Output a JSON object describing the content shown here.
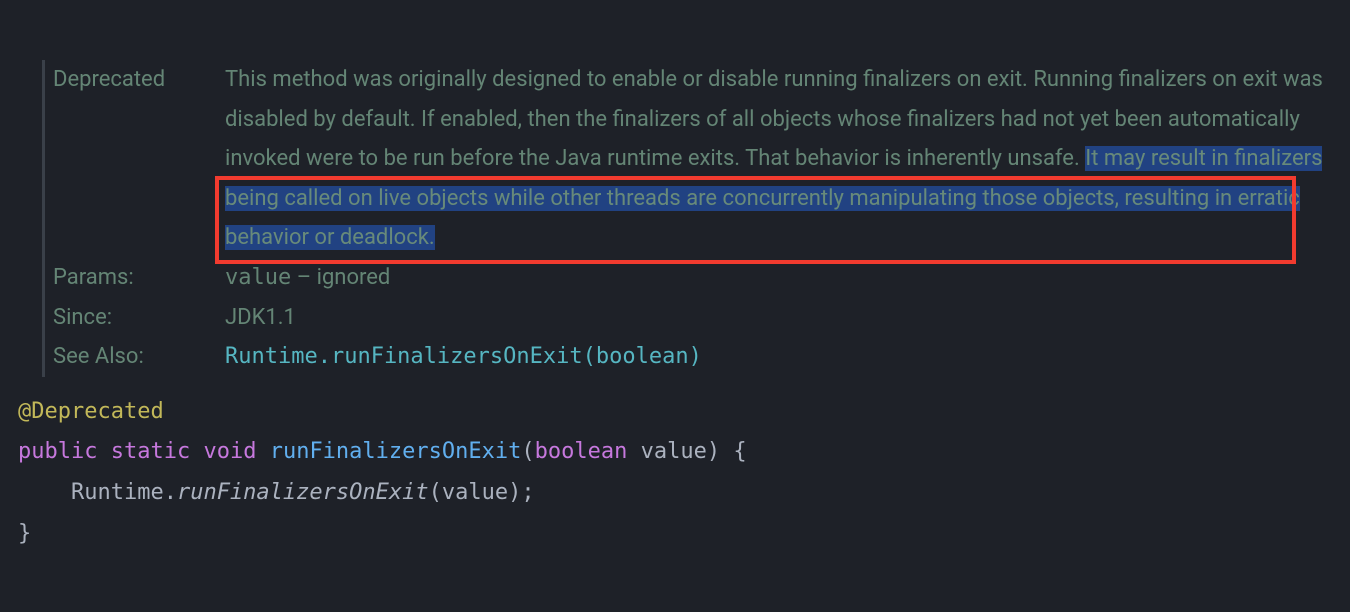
{
  "javadoc": {
    "deprecated": {
      "label": "Deprecated",
      "text_part1": "This method was originally designed to enable or disable running finalizers on exit. Running finalizers on exit was disabled by default. If enabled, then the finalizers of all objects whose finalizers had not yet been automatically invoked were to be run before the Java runtime exits. That behavior is inherently unsafe. ",
      "text_highlighted": "It may result in finalizers being called on live objects while other threads are concurrently manipulating those objects, resulting in erratic behavior or deadlock."
    },
    "params": {
      "label": "Params:",
      "name": "value",
      "dash": " – ",
      "desc": "ignored"
    },
    "since": {
      "label": "Since:",
      "value": "JDK1.1"
    },
    "seealso": {
      "label": "See Also:",
      "link": "Runtime.runFinalizersOnExit(boolean)"
    }
  },
  "code": {
    "annotation": "@Deprecated",
    "kw_public": "public",
    "kw_static": "static",
    "kw_void": "void",
    "method": "runFinalizersOnExit",
    "paren_open": "(",
    "kw_boolean": "boolean",
    "param": "value",
    "paren_close_brace": ") {",
    "body_class": "Runtime",
    "body_dot": ".",
    "body_method": "runFinalizersOnExit",
    "body_call": "(value);",
    "close_brace": "}"
  }
}
